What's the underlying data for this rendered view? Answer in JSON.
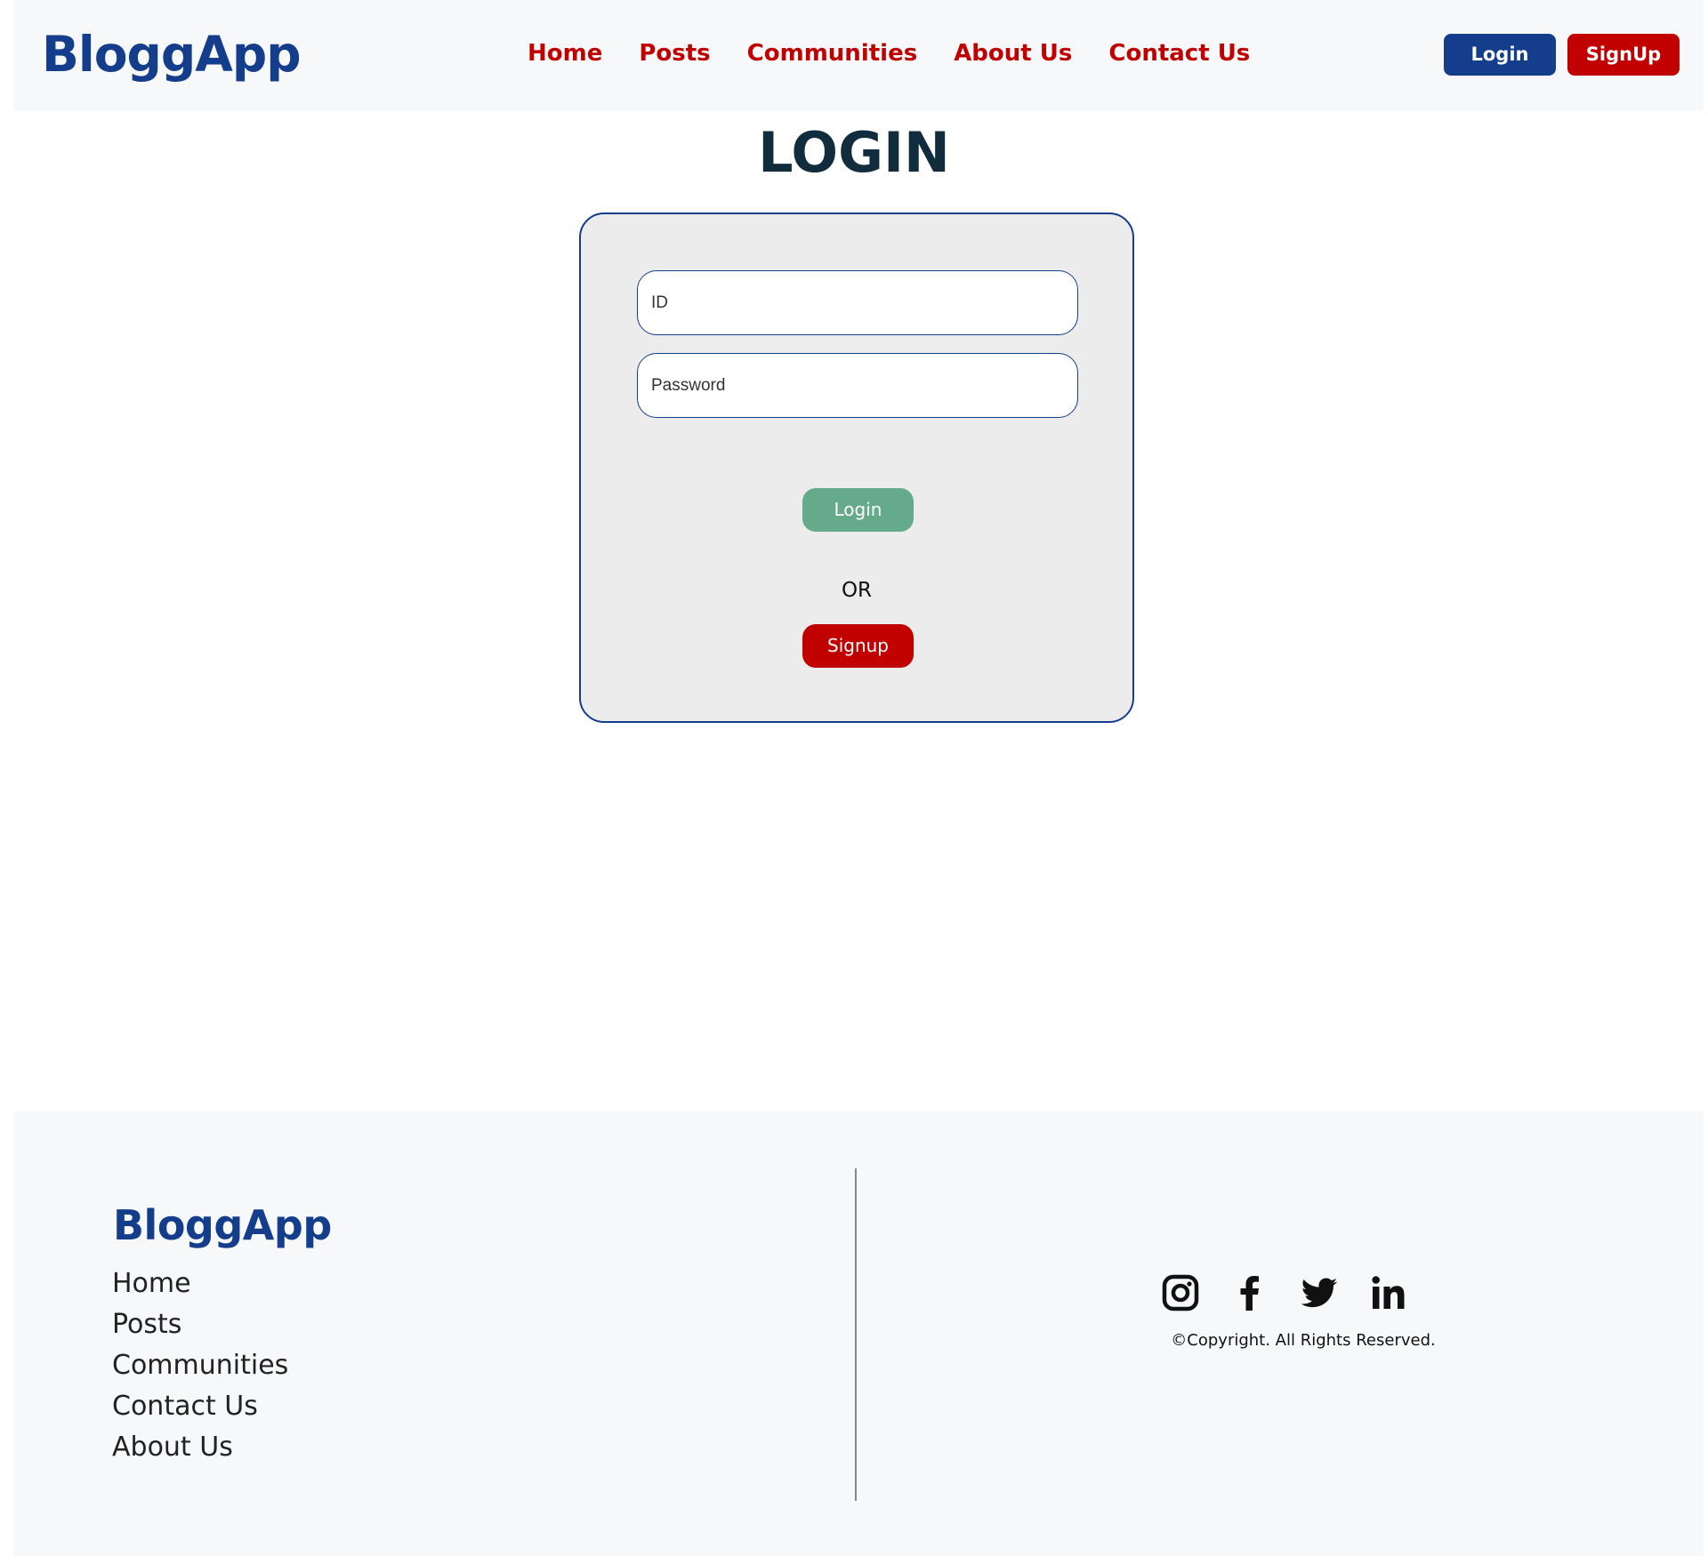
{
  "header": {
    "brand": "BloggApp",
    "nav": [
      "Home",
      "Posts",
      "Communities",
      "About Us",
      "Contact Us"
    ],
    "login_label": "Login",
    "signup_label": "SignUp"
  },
  "login": {
    "title": "LOGIN",
    "id_placeholder": "ID",
    "password_placeholder": "Password",
    "login_button": "Login",
    "or_text": "OR",
    "signup_button": "Signup"
  },
  "footer": {
    "brand": "BloggApp",
    "links": [
      "Home",
      "Posts",
      "Communities",
      "Contact Us",
      "About Us"
    ],
    "socials": [
      "instagram-icon",
      "facebook-icon",
      "twitter-icon",
      "linkedin-icon"
    ],
    "copyright": "©Copyright. All Rights Reserved."
  },
  "colors": {
    "brand_blue": "#143d8c",
    "accent_red": "#c10000",
    "login_green": "#66aa8c",
    "title_dark": "#112d3d",
    "card_bg": "#ececec",
    "bar_bg": "#f7f8fa"
  }
}
